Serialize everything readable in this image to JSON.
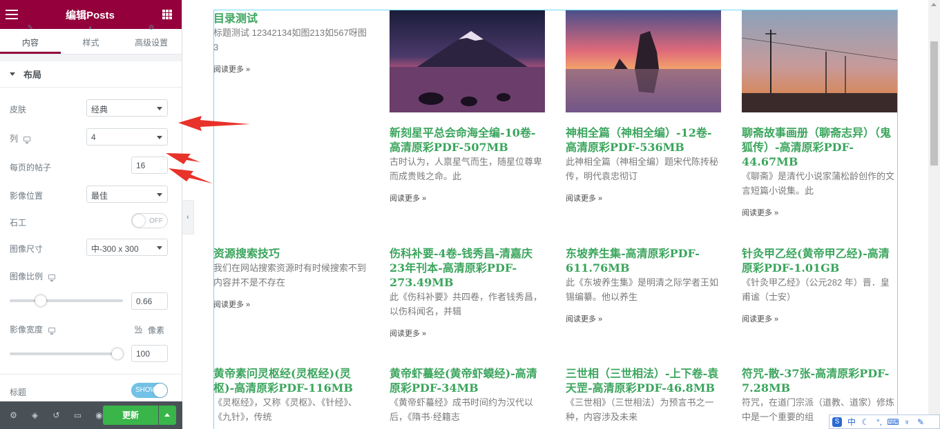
{
  "panel": {
    "title": "编辑Posts",
    "tabs": [
      {
        "label": "内容",
        "active": true
      },
      {
        "label": "样式",
        "active": false
      },
      {
        "label": "高级设置",
        "active": false
      }
    ],
    "section_title": "布局",
    "controls": {
      "skin": {
        "label": "皮肤",
        "value": "经典"
      },
      "columns": {
        "label": "列",
        "value": "4"
      },
      "posts_per_page": {
        "label": "每页的帖子",
        "value": "16"
      },
      "image_position": {
        "label": "影像位置",
        "value": "最佳"
      },
      "masonry": {
        "label": "石工",
        "state": "OFF"
      },
      "image_size": {
        "label": "图像尺寸",
        "value": "中-300 x 300"
      },
      "image_ratio": {
        "label": "图像比例",
        "value": "0.66",
        "level": 0.25
      },
      "image_width": {
        "label": "影像宽度",
        "value": "100",
        "unit_pct": "%",
        "unit_px": "像素",
        "level": 1.0
      },
      "title": {
        "label": "标题",
        "state": "SHOW"
      }
    },
    "footer": {
      "update_label": "更新"
    },
    "colors": {
      "header_bg": "#93003c",
      "update_button": "#39b54a",
      "switch_on": "#72c1e6",
      "title_green": "#3ba55d",
      "arrow_red": "#e8322a"
    }
  },
  "posts": [
    {
      "title": "目录测试",
      "excerpt": "标题测试 12342134如图213如567呀图3",
      "more": "阅读更多 »",
      "has_image": false
    },
    {
      "title": "新刻星平总会命海全编-10卷-高清原彩PDF-507MB",
      "excerpt": "古时认为，人禀星气而生，随星位尊卑而成贵贱之命。此",
      "more": "阅读更多 »",
      "has_image": true,
      "image": "mountain-lake"
    },
    {
      "title": "神相全篇（神相全编）-12卷-高清原彩PDF-536MB",
      "excerpt": "此神相全篇（神相全编）题宋代陈抟秘传，明代袁忠彻订",
      "more": "阅读更多 »",
      "has_image": true,
      "image": "sea-rock-sunset"
    },
    {
      "title": "聊斋故事画册（聊斋志异）（鬼狐传）-高清原彩PDF-44.67MB",
      "excerpt": "《聊斋》是清代小说家蒲松龄创作的文言短篇小说集。此",
      "more": "阅读更多 »",
      "has_image": true,
      "image": "power-lines-dusk"
    },
    {
      "title": "资源搜索技巧",
      "excerpt": "我们在网站搜索资源时有时候搜索不到内容并不是不存在",
      "more": "阅读更多 »",
      "has_image": false
    },
    {
      "title": "伤科补要-4卷-钱秀昌-清嘉庆23年刊本-高清原彩PDF-273.49MB",
      "excerpt": "此《伤科补要》共四卷，作者钱秀昌，以伤科闻名，并辑",
      "more": "阅读更多 »",
      "has_image": false
    },
    {
      "title": "东坡养生集-高清原彩PDF-611.76MB",
      "excerpt": "此《东坡养生集》是明清之际学者王如锡编纂。他以养生",
      "more": "阅读更多 »",
      "has_image": false
    },
    {
      "title": "针灸甲乙经(黄帝甲乙经)-高清原彩PDF-1.01GB",
      "excerpt": "《针灸甲乙经》（公元282 年）晋．皇甫谧（士安）",
      "more": "阅读更多 »",
      "has_image": false
    },
    {
      "title": "黄帝素问灵枢经(灵枢经)(灵枢)-高清原彩PDF-116MB",
      "excerpt": "《灵枢经》，又称《灵枢》、《针经》、《九针》，传统",
      "more": "",
      "has_image": false
    },
    {
      "title": "黄帝虾蟇经(黄帝虾蟆经)-高清原彩PDF-34MB",
      "excerpt": "《黄帝虾蟇经》成书时间约为汉代以后，《隋书·经籍志",
      "more": "",
      "has_image": false
    },
    {
      "title": "三世相（三世相法）-上下卷-袁天罡-高清原彩PDF-46.8MB",
      "excerpt": "《三世相》（三世相法）为预言书之一种，内容涉及未来",
      "more": "",
      "has_image": false
    },
    {
      "title": "符咒-散-37张-高清原彩PDF-7.28MB",
      "excerpt": "符咒，在道门宗派（道教、道家）修炼中是一个重要的组",
      "more": "",
      "has_image": false
    }
  ],
  "ime": {
    "lang": "中"
  }
}
